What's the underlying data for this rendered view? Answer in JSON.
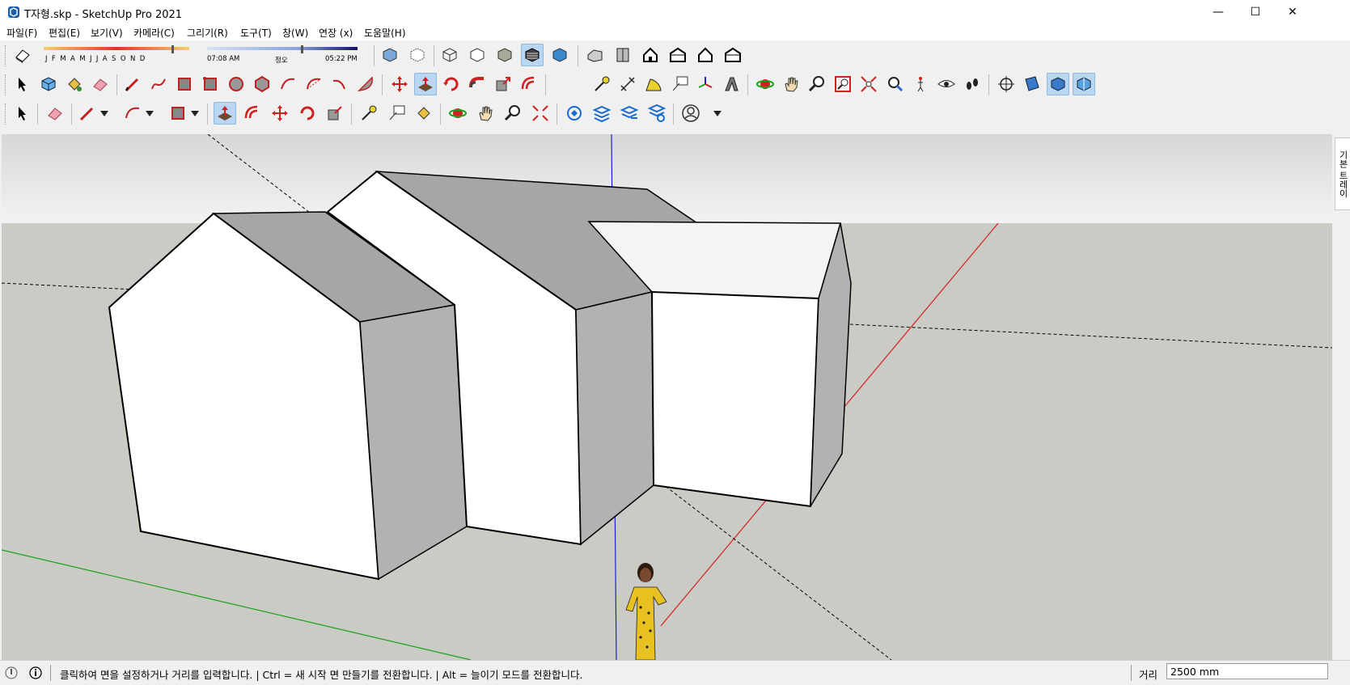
{
  "window": {
    "title": "T자형.skp - SketchUp Pro 2021",
    "minimize_glyph": "—",
    "maximize_glyph": "☐",
    "close_glyph": "✕"
  },
  "menu": [
    {
      "label": "파일(F)"
    },
    {
      "label": "편집(E)"
    },
    {
      "label": "보기(V)"
    },
    {
      "label": "카메라(C)"
    },
    {
      "label": "그리기(R)"
    },
    {
      "label": "도구(T)"
    },
    {
      "label": "창(W)"
    },
    {
      "label": "연장 (x)"
    },
    {
      "label": "도움말(H)"
    }
  ],
  "shadows": {
    "months": [
      "J",
      "F",
      "M",
      "A",
      "M",
      "J",
      "J",
      "A",
      "S",
      "O",
      "N",
      "D"
    ],
    "time_start": "07:08 AM",
    "time_noon": "정오",
    "time_end": "05:22 PM"
  },
  "tray": {
    "label": "기본 트레이"
  },
  "status": {
    "message": "클릭하여 면을 설정하거나 거리를 입력합니다. | Ctrl = 새 시작 면 만들기를 전환합니다. | Alt = 늘이기 모드를 전환합니다.",
    "vcb_label": "거리",
    "vcb_value": "2500 mm"
  },
  "colors": {
    "sky_top": "#d6d8d8",
    "sky_bottom": "#f2f3f3",
    "ground": "#cbcbc5",
    "red_axis": "#d42020",
    "green_axis": "#1aa01a",
    "blue_axis": "#2020d0",
    "face_front": "#ffffff",
    "face_side": "#b2b2b2",
    "face_roof": "#a6a6a6",
    "active_tool": "#b9d6f2"
  }
}
